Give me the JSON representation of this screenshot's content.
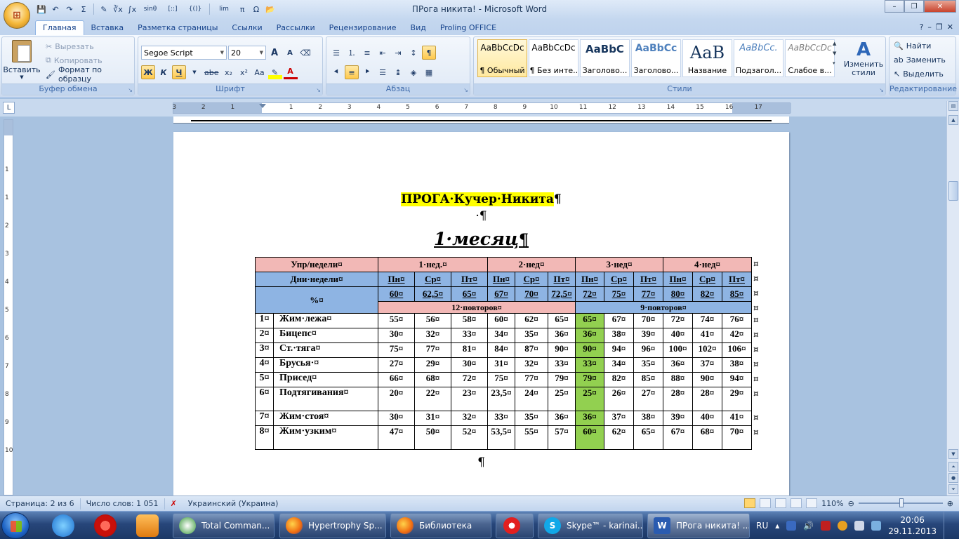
{
  "window": {
    "title": "ПРога никита! - Microsoft Word",
    "controls": [
      "–",
      "❐",
      "✕"
    ]
  },
  "qat": [
    "💾",
    "↶",
    "↷",
    "Σ",
    "✎",
    "∛x",
    "∫x",
    "sinθ",
    "[::]",
    "{()}",
    "lim",
    "π",
    "Ω",
    "📂"
  ],
  "tabs": [
    "Главная",
    "Вставка",
    "Разметка страницы",
    "Ссылки",
    "Рассылки",
    "Рецензирование",
    "Вид",
    "Proling OFFICE"
  ],
  "ribbon": {
    "clipboard": {
      "title": "Буфер обмена",
      "paste": "Вставить",
      "cut": "Вырезать",
      "copy": "Копировать",
      "format_painter": "Формат по образцу"
    },
    "font": {
      "title": "Шрифт",
      "font_name": "Segoe Script",
      "font_size": "20",
      "bold": "Ж",
      "italic": "К",
      "underline": "Ч",
      "strike": "abe",
      "sub": "x₂",
      "sup": "x²",
      "case": "Aa",
      "grow": "A",
      "shrink": "A"
    },
    "paragraph": {
      "title": "Абзац",
      "pilcrow": "¶"
    },
    "styles": {
      "title": "Стили",
      "items": [
        {
          "preview": "AaBbCcDc",
          "name": "¶ Обычный"
        },
        {
          "preview": "AaBbCcDc",
          "name": "¶ Без инте..."
        },
        {
          "preview": "AaBbC",
          "name": "Заголово..."
        },
        {
          "preview": "AaBbCc",
          "name": "Заголово..."
        },
        {
          "preview": "AaB",
          "name": "Название"
        },
        {
          "preview": "AaBbCc.",
          "name": "Подзагол..."
        },
        {
          "preview": "AaBbCcDc",
          "name": "Слабое в..."
        }
      ],
      "change": "Изменить стили"
    },
    "editing": {
      "title": "Редактирование",
      "find": "Найти",
      "replace": "Заменить",
      "select": "Выделить"
    }
  },
  "ruler": {
    "ticks": [
      "3",
      "2",
      "1",
      "1",
      "2",
      "3",
      "4",
      "5",
      "6",
      "7",
      "8",
      "9",
      "10",
      "11",
      "12",
      "13",
      "14",
      "15",
      "16",
      "17"
    ],
    "vticks": [
      "1",
      "2",
      "1",
      "1",
      "2",
      "3",
      "4",
      "5",
      "6",
      "7",
      "8",
      "9",
      "10"
    ]
  },
  "document": {
    "title": "ПРОГА·Кучер·Никита",
    "pilcrow": "¶",
    "center_pilcrow": "·¶",
    "month": "1·месяц",
    "month_mark": "¶",
    "cell_end": "¤",
    "table": {
      "h_exercise": "Упр/недели¤",
      "weeks": [
        "1·нед.¤",
        "2·нед¤",
        "3·нед¤",
        "4·нед¤"
      ],
      "h_days": "Дни·недели¤",
      "days": [
        "Пн¤",
        "Ср¤",
        "Пт¤",
        "Пн¤",
        "Ср¤",
        "Пт¤",
        "Пн¤",
        "Ср¤",
        "Пт¤",
        "Пн¤",
        "Ср¤",
        "Пт¤"
      ],
      "h_percent": "%¤",
      "percents": [
        "60¤",
        "62,5¤",
        "65¤",
        "67¤",
        "70¤",
        "72,5¤",
        "72¤",
        "75¤",
        "77¤",
        "80¤",
        "82¤",
        "85¤"
      ],
      "reps_a": "12·повторов¤",
      "reps_b": "9·повторов¤",
      "rows": [
        {
          "n": "1¤",
          "name": "Жим·лежа¤",
          "v": [
            "55¤",
            "56¤",
            "58¤",
            "60¤",
            "62¤",
            "65¤",
            "65¤",
            "67¤",
            "70¤",
            "72¤",
            "74¤",
            "76¤"
          ],
          "tall": false
        },
        {
          "n": "2¤",
          "name": "Бицепс¤",
          "v": [
            "30¤",
            "32¤",
            "33¤",
            "34¤",
            "35¤",
            "36¤",
            "36¤",
            "38¤",
            "39¤",
            "40¤",
            "41¤",
            "42¤"
          ],
          "tall": false
        },
        {
          "n": "3¤",
          "name": "Ст.·тяга¤",
          "v": [
            "75¤",
            "77¤",
            "81¤",
            "84¤",
            "87¤",
            "90¤",
            "90¤",
            "94¤",
            "96¤",
            "100¤",
            "102¤",
            "106¤"
          ],
          "tall": false
        },
        {
          "n": "4¤",
          "name": "Брусья·¤",
          "v": [
            "27¤",
            "29¤",
            "30¤",
            "31¤",
            "32¤",
            "33¤",
            "33¤",
            "34¤",
            "35¤",
            "36¤",
            "37¤",
            "38¤"
          ],
          "tall": false
        },
        {
          "n": "5¤",
          "name": "Присед¤",
          "v": [
            "66¤",
            "68¤",
            "72¤",
            "75¤",
            "77¤",
            "79¤",
            "79¤",
            "82¤",
            "85¤",
            "88¤",
            "90¤",
            "94¤"
          ],
          "tall": false
        },
        {
          "n": "6¤",
          "name": "Подтягивания¤",
          "v": [
            "20¤",
            "22¤",
            "23¤",
            "23,5¤",
            "24¤",
            "25¤",
            "25¤",
            "26¤",
            "27¤",
            "28¤",
            "28¤",
            "29¤"
          ],
          "tall": true
        },
        {
          "n": "7¤",
          "name": "Жим·стоя¤",
          "v": [
            "30¤",
            "31¤",
            "32¤",
            "33¤",
            "35¤",
            "36¤",
            "36¤",
            "37¤",
            "38¤",
            "39¤",
            "40¤",
            "41¤"
          ],
          "tall": false
        },
        {
          "n": "8¤",
          "name": "Жим·узким¤",
          "v": [
            "47¤",
            "50¤",
            "52¤",
            "53,5¤",
            "55¤",
            "57¤",
            "60¤",
            "62¤",
            "65¤",
            "67¤",
            "68¤",
            "70¤"
          ],
          "tall": true
        }
      ],
      "after": "¶"
    }
  },
  "status": {
    "page": "Страница: 2 из 6",
    "words": "Число слов: 1 051",
    "lang": "Украинский (Украина)",
    "zoom": "110%"
  },
  "taskbar": {
    "tasks": [
      "Total Comman...",
      "Hypertrophy Sp...",
      "Библиотека",
      "",
      "Skype™ - karinai...",
      "ПРога никита! ..."
    ],
    "lang": "RU",
    "time": "20:06",
    "date": "29.11.2013"
  },
  "colors": {
    "pink": "#f2b8b6",
    "blue": "#8eb4e3",
    "green": "#92d050",
    "highlight": "#ffff00"
  }
}
